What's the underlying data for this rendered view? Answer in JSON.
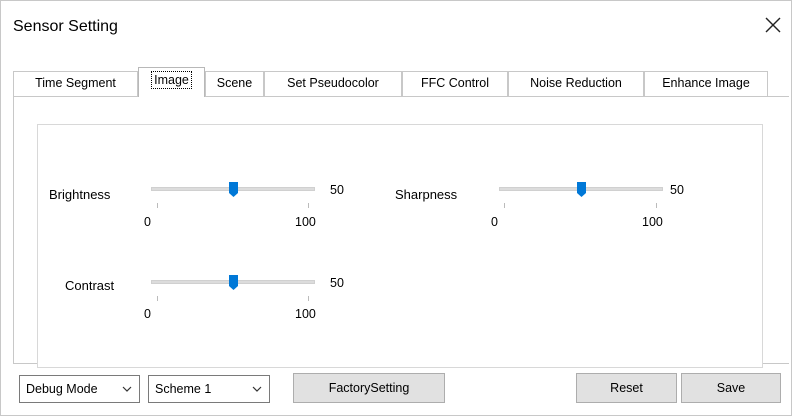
{
  "window": {
    "title": "Sensor Setting"
  },
  "tabs": [
    {
      "label": "Time Segment"
    },
    {
      "label": "Image"
    },
    {
      "label": "Scene"
    },
    {
      "label": "Set Pseudocolor"
    },
    {
      "label": "FFC Control"
    },
    {
      "label": "Noise Reduction"
    },
    {
      "label": "Enhance Image"
    }
  ],
  "active_tab": "Image",
  "sliders": {
    "brightness": {
      "label": "Brightness",
      "value": "50",
      "min": "0",
      "max": "100",
      "level": 50
    },
    "sharpness": {
      "label": "Sharpness",
      "value": "50",
      "min": "0",
      "max": "100",
      "level": 50
    },
    "contrast": {
      "label": "Contrast",
      "value": "50",
      "min": "0",
      "max": "100",
      "level": 50
    }
  },
  "footer": {
    "mode_select": "Debug Mode",
    "scheme_select": "Scheme 1",
    "factory_label": "FactorySetting",
    "reset_label": "Reset",
    "save_label": "Save"
  },
  "colors": {
    "thumb": "#0078d7",
    "track": "#dcdcdc",
    "button": "#e1e1e1"
  }
}
